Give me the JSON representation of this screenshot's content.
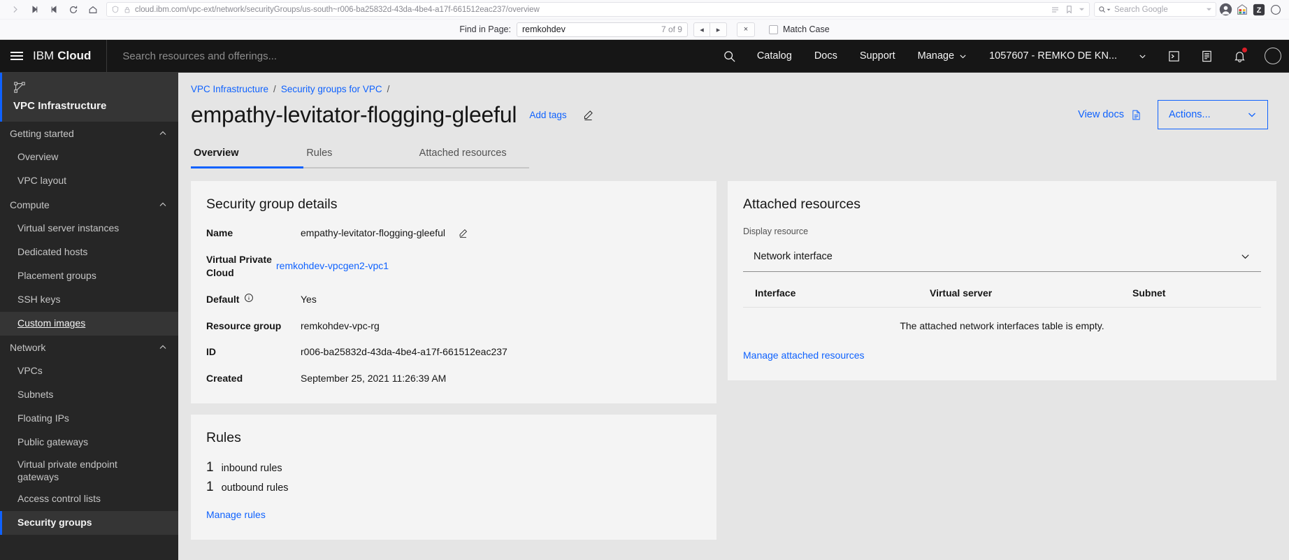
{
  "browser": {
    "url_prefix": "cloud.",
    "url_host_bold": "ibm.com",
    "url_path": "/vpc-ext/network/securityGroups/us-south~r006-ba25832d-43da-4be4-a17f-661512eac237/overview",
    "url_full": "cloud.ibm.com/vpc-ext/network/securityGroups/us-south~r006-ba25832d-43da-4be4-a17f-661512eac237/overview",
    "search_placeholder": "Search Google",
    "icons": {
      "forward": "forward-arrow-icon",
      "first": "skip-back-icon",
      "last": "skip-forward-icon",
      "reload": "reload-icon",
      "home": "home-icon",
      "shield": "shield-icon",
      "lock": "lock-icon",
      "reader": "reader-view-icon",
      "bookmark": "bookmark-icon",
      "account": "account-avatar-icon",
      "ext1": "extension-colored-icon",
      "ext2": "zotero-extension-icon"
    }
  },
  "findbar": {
    "label": "Find in Page:",
    "query": "remkohdev",
    "count": "7 of 9",
    "prev": "◂",
    "next": "▸",
    "close": "×",
    "match_case": "Match Case"
  },
  "header": {
    "brand_ibm": "IBM",
    "brand_cloud": "Cloud",
    "search_placeholder": "Search resources and offerings...",
    "nav": [
      {
        "label": "Catalog",
        "caret": false
      },
      {
        "label": "Docs",
        "caret": false
      },
      {
        "label": "Support",
        "caret": false
      },
      {
        "label": "Manage",
        "caret": true
      },
      {
        "label": "1057607 - REMKO DE KN...",
        "caret": true
      }
    ]
  },
  "sidebar": {
    "product": "VPC Infrastructure",
    "groups": [
      {
        "label": "Getting started",
        "items": [
          {
            "label": "Overview",
            "state": ""
          },
          {
            "label": "VPC layout",
            "state": ""
          }
        ]
      },
      {
        "label": "Compute",
        "items": [
          {
            "label": "Virtual server instances",
            "state": ""
          },
          {
            "label": "Dedicated hosts",
            "state": ""
          },
          {
            "label": "Placement groups",
            "state": ""
          },
          {
            "label": "SSH keys",
            "state": ""
          },
          {
            "label": "Custom images",
            "state": "hover"
          }
        ]
      },
      {
        "label": "Network",
        "items": [
          {
            "label": "VPCs",
            "state": ""
          },
          {
            "label": "Subnets",
            "state": ""
          },
          {
            "label": "Floating IPs",
            "state": ""
          },
          {
            "label": "Public gateways",
            "state": ""
          },
          {
            "label": "Virtual private endpoint gateways",
            "state": ""
          },
          {
            "label": "Access control lists",
            "state": ""
          },
          {
            "label": "Security groups",
            "state": "selected"
          }
        ]
      }
    ]
  },
  "main": {
    "breadcrumb": [
      {
        "label": "VPC Infrastructure"
      },
      {
        "label": "Security groups for VPC"
      }
    ],
    "title": "empathy-levitator-flogging-gleeful",
    "add_tags": "Add tags",
    "view_docs": "View docs",
    "actions_label": "Actions...",
    "tabs": [
      {
        "label": "Overview",
        "active": true
      },
      {
        "label": "Rules",
        "active": false
      },
      {
        "label": "Attached resources",
        "active": false
      }
    ],
    "details_card": {
      "title": "Security group details",
      "rows": [
        {
          "key": "Name",
          "value": "empathy-levitator-flogging-gleeful",
          "link": false,
          "info": false,
          "edit": true
        },
        {
          "key": "Virtual Private Cloud",
          "value": "remkohdev-vpcgen2-vpc1",
          "link": true,
          "info": false,
          "edit": false
        },
        {
          "key": "Default",
          "value": "Yes",
          "link": false,
          "info": true,
          "edit": false
        },
        {
          "key": "Resource group",
          "value": "remkohdev-vpc-rg",
          "link": false,
          "info": false,
          "edit": false
        },
        {
          "key": "ID",
          "value": "r006-ba25832d-43da-4be4-a17f-661512eac237",
          "link": false,
          "info": false,
          "edit": false
        },
        {
          "key": "Created",
          "value": "September 25, 2021 11:26:39 AM",
          "link": false,
          "info": false,
          "edit": false
        }
      ]
    },
    "rules_card": {
      "title": "Rules",
      "inbound_count": "1",
      "inbound_label": "inbound rules",
      "outbound_count": "1",
      "outbound_label": "outbound rules",
      "manage_link": "Manage rules"
    },
    "attached_card": {
      "title": "Attached resources",
      "select_label": "Display resource",
      "select_value": "Network interface",
      "columns": [
        "Interface",
        "Virtual server",
        "Subnet"
      ],
      "empty_text": "The attached network interfaces table is empty.",
      "manage_link": "Manage attached resources"
    }
  },
  "colors": {
    "accent_blue": "#0f62fe",
    "header_black": "#161616",
    "sidebar_gray": "#262626",
    "card_gray": "#f4f4f4",
    "page_gray": "#e5e5e5",
    "notification_red": "#da1e28"
  }
}
